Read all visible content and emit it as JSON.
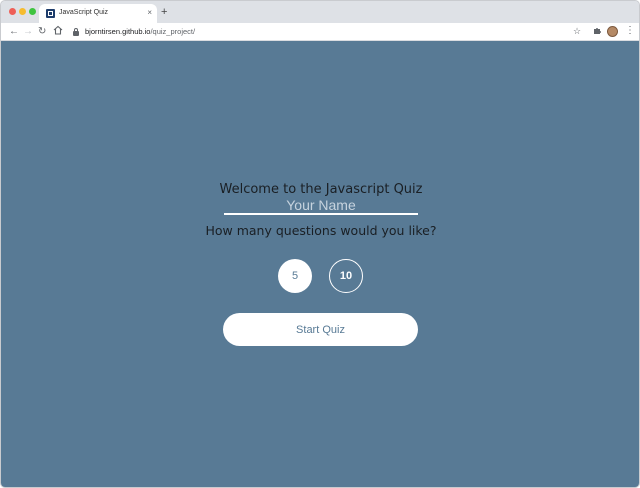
{
  "browser": {
    "tab_title": "JavaScript Quiz",
    "tab_close": "×",
    "new_tab": "+",
    "url_host": "bjorntirsen.github.io",
    "url_path": "/quiz_project/",
    "icons": {
      "back": "back-arrow-icon",
      "forward": "forward-arrow-icon",
      "reload": "reload-icon",
      "home": "home-icon",
      "lock": "lock-icon",
      "bookmark": "star-icon",
      "extensions": "puzzle-icon",
      "menu": "kebab-menu-icon"
    }
  },
  "quiz": {
    "welcome": "Welcome to the Javascript Quiz",
    "name_placeholder": "Your Name",
    "question_prompt": "How many questions would you like?",
    "options": [
      "5",
      "10"
    ],
    "start_label": "Start Quiz"
  },
  "colors": {
    "background": "#587a95",
    "accent": "#ffffff"
  }
}
